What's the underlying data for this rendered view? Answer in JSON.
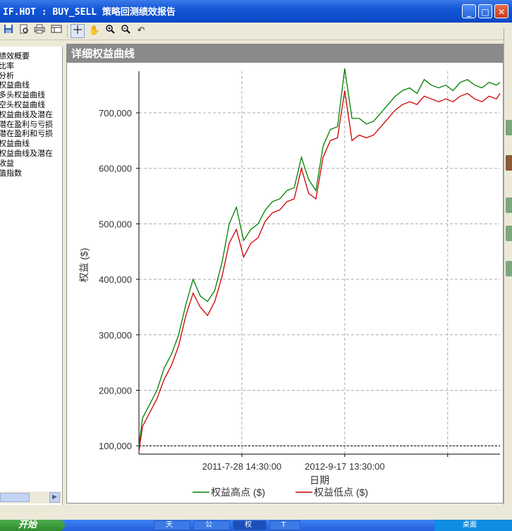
{
  "window": {
    "title": "IF.HOT : BUY_SELL 策略回测绩效报告",
    "buttons": {
      "minimize": "_",
      "maximize": "□",
      "close": "✕"
    }
  },
  "toolbar": {
    "items": [
      "save-icon",
      "preview-icon",
      "print-icon",
      "table-icon",
      "crosshair-icon",
      "hand-icon",
      "zoom-in-icon",
      "zoom-out-icon",
      "reset-icon"
    ],
    "pressed": "crosshair-icon"
  },
  "sidebar": {
    "items": [
      "绩效概要",
      "比率",
      "分析",
      "权益曲线",
      "多头权益曲线",
      "空头权益曲线",
      "权益曲线及潜在",
      "潜在盈利与亏损",
      "潜在盈利和亏损",
      "权益曲线",
      "权益曲线及潜在",
      "收益",
      "值指数"
    ]
  },
  "panel": {
    "title": "详细权益曲线"
  },
  "chart_data": {
    "type": "line",
    "title": "",
    "xlabel": "日期",
    "ylabel": "权益 ($)",
    "ylim": [
      85000,
      775000
    ],
    "yticks": [
      100000,
      200000,
      300000,
      400000,
      500000,
      600000,
      700000
    ],
    "ytick_labels": [
      "100,000",
      "200,000",
      "300,000",
      "400,000",
      "500,000",
      "600,000",
      "700,000"
    ],
    "xtick_labels": [
      "2011-7-28 14:30:00",
      "2012-9-17 13:30:00"
    ],
    "reference_line": 100000,
    "grid": true,
    "legend_position": "bottom",
    "x": [
      0,
      0.01,
      0.03,
      0.05,
      0.07,
      0.09,
      0.11,
      0.13,
      0.15,
      0.17,
      0.19,
      0.21,
      0.23,
      0.25,
      0.27,
      0.29,
      0.31,
      0.33,
      0.35,
      0.37,
      0.39,
      0.41,
      0.43,
      0.45,
      0.47,
      0.49,
      0.51,
      0.53,
      0.55,
      0.57,
      0.59,
      0.61,
      0.63,
      0.65,
      0.67,
      0.69,
      0.71,
      0.73,
      0.75,
      0.77,
      0.79,
      0.81,
      0.83,
      0.85,
      0.87,
      0.89,
      0.91,
      0.93,
      0.95,
      0.97,
      0.99,
      1.0
    ],
    "series": [
      {
        "name": "权益高点 ($)",
        "color": "#008000",
        "values": [
          100000,
          150000,
          175000,
          200000,
          240000,
          265000,
          300000,
          355000,
          400000,
          370000,
          360000,
          380000,
          430000,
          500000,
          530000,
          470000,
          490000,
          500000,
          525000,
          540000,
          545000,
          560000,
          565000,
          620000,
          580000,
          560000,
          640000,
          670000,
          675000,
          780000,
          690000,
          690000,
          680000,
          685000,
          700000,
          715000,
          730000,
          740000,
          745000,
          735000,
          760000,
          750000,
          745000,
          750000,
          740000,
          755000,
          760000,
          750000,
          745000,
          755000,
          750000,
          755000
        ]
      },
      {
        "name": "权益低点 ($)",
        "color": "#cc0000",
        "values": [
          90000,
          135000,
          160000,
          185000,
          220000,
          245000,
          280000,
          335000,
          375000,
          350000,
          335000,
          360000,
          405000,
          465000,
          490000,
          440000,
          465000,
          475000,
          505000,
          520000,
          525000,
          540000,
          545000,
          600000,
          555000,
          545000,
          620000,
          650000,
          655000,
          740000,
          650000,
          660000,
          655000,
          660000,
          675000,
          690000,
          705000,
          715000,
          720000,
          715000,
          730000,
          725000,
          720000,
          725000,
          720000,
          730000,
          735000,
          725000,
          720000,
          730000,
          725000,
          735000
        ]
      }
    ]
  },
  "taskbar": {
    "start_label": "开始",
    "items": [
      "天",
      "公",
      "权",
      "T"
    ],
    "tray_text": "桌面"
  },
  "colors": {
    "title_bar": "#0a47c4",
    "panel_header": "#8a8a8a",
    "equity_high": "#008000",
    "equity_low": "#cc0000"
  }
}
